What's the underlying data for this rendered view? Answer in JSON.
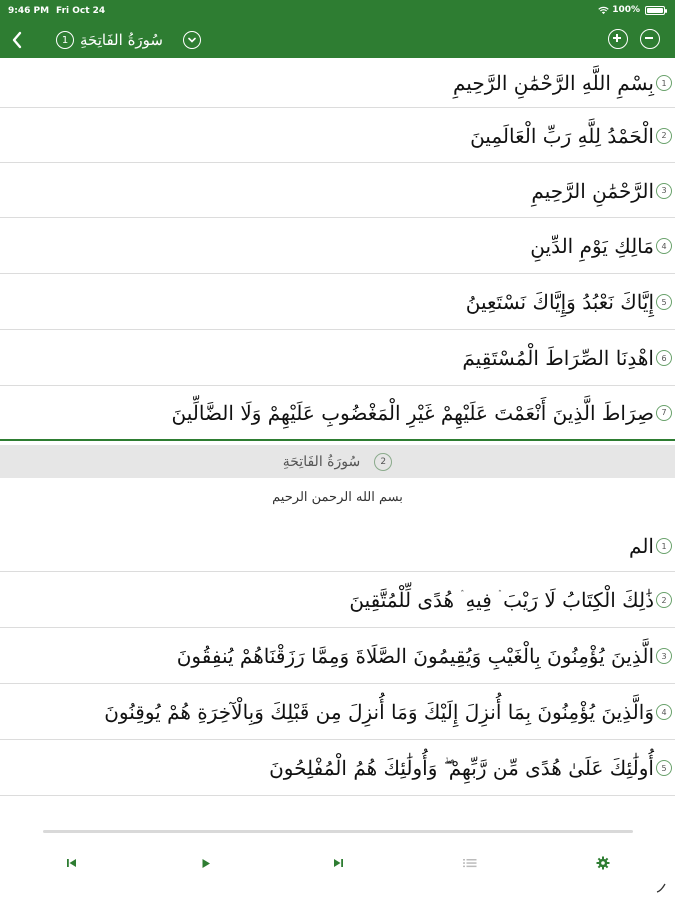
{
  "status_bar": {
    "time": "9:46 PM",
    "date": "Fri Oct 24",
    "battery_text": "100%",
    "battery_level": 1.0
  },
  "header": {
    "surah_number": "1",
    "surah_title": "سُورَةُ الفَاتِحَةِ"
  },
  "colors": {
    "accent": "#2e7d32",
    "header_band": "#e6e6e6",
    "separator": "#dcdcdc"
  },
  "surah1": {
    "verses": [
      {
        "num": "1",
        "text": "بِسْمِ اللَّهِ الرَّحْمَٰنِ الرَّحِيمِ"
      },
      {
        "num": "2",
        "text": "الْحَمْدُ لِلَّهِ رَبِّ الْعَالَمِينَ"
      },
      {
        "num": "3",
        "text": "الرَّحْمَٰنِ الرَّحِيمِ"
      },
      {
        "num": "4",
        "text": "مَالِكِ يَوْمِ الدِّينِ"
      },
      {
        "num": "5",
        "text": "إِيَّاكَ نَعْبُدُ وَإِيَّاكَ نَسْتَعِينُ"
      },
      {
        "num": "6",
        "text": "اهْدِنَا الصِّرَاطَ الْمُسْتَقِيمَ"
      },
      {
        "num": "7",
        "text": "صِرَاطَ الَّذِينَ أَنْعَمْتَ عَلَيْهِمْ غَيْرِ الْمَغْضُوبِ عَلَيْهِمْ وَلَا الضَّالِّينَ"
      }
    ]
  },
  "surah2": {
    "header_name": "سُورَةُ الفَاتِحَةِ",
    "header_number": "2",
    "basmala": "بسم الله الرحمن الرحيم",
    "verses": [
      {
        "num": "1",
        "text": "الم"
      },
      {
        "num": "2",
        "text": "ذَٰلِكَ الْكِتَابُ لَا رَيْبَ ۛ فِيهِ ۛ هُدًى لِّلْمُتَّقِينَ"
      },
      {
        "num": "3",
        "text": "الَّذِينَ يُؤْمِنُونَ بِالْغَيْبِ وَيُقِيمُونَ الصَّلَاةَ وَمِمَّا رَزَقْنَاهُمْ يُنفِقُونَ"
      },
      {
        "num": "4",
        "text": "وَالَّذِينَ يُؤْمِنُونَ بِمَا أُنزِلَ إِلَيْكَ وَمَا أُنزِلَ مِن قَبْلِكَ وَبِالْآخِرَةِ هُمْ يُوقِنُونَ"
      },
      {
        "num": "5",
        "text": "أُولَٰئِكَ عَلَىٰ هُدًى مِّن رَّبِّهِمْ ۖ وَأُولَٰئِكَ هُمُ الْمُفْلِحُونَ"
      }
    ]
  },
  "player": {
    "icons": [
      "skip-previous-icon",
      "play-icon",
      "skip-next-icon",
      "list-icon",
      "settings-icon"
    ]
  }
}
